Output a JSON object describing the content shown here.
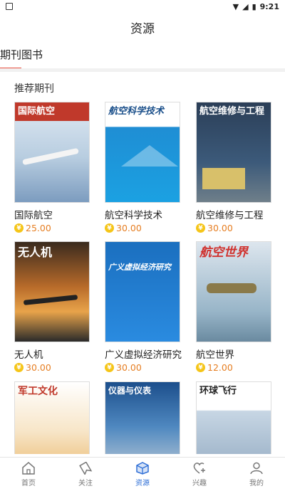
{
  "status_bar": {
    "time": "9:21"
  },
  "header": {
    "title": "资源"
  },
  "subtabs": {
    "active_label": "期刊图书"
  },
  "section": {
    "title": "推荐期刊"
  },
  "journals": [
    {
      "name": "国际航空",
      "price": "25.00",
      "cover_text": "国际航空"
    },
    {
      "name": "航空科学技术",
      "price": "30.00",
      "cover_text": "航空科学技术"
    },
    {
      "name": "航空维修与工程",
      "price": "30.00",
      "cover_text": "航空维修与工程"
    },
    {
      "name": "无人机",
      "price": "30.00",
      "cover_text": "无人机"
    },
    {
      "name": "广义虚拟经济研究",
      "price": "30.00",
      "cover_text": "广义虚拟经济研究"
    },
    {
      "name": "航空世界",
      "price": "12.00",
      "cover_text": "航空世界"
    },
    {
      "name": "",
      "price": "",
      "cover_text": "军工文化"
    },
    {
      "name": "",
      "price": "",
      "cover_text": "仪器与仪表"
    },
    {
      "name": "",
      "price": "",
      "cover_text": "环球飞行"
    }
  ],
  "bottom_nav": {
    "items": [
      {
        "label": "首页",
        "icon": "home-icon"
      },
      {
        "label": "关注",
        "icon": "bookmark-icon"
      },
      {
        "label": "资源",
        "icon": "box-icon"
      },
      {
        "label": "兴趣",
        "icon": "heart-plus-icon"
      },
      {
        "label": "我的",
        "icon": "user-icon"
      }
    ],
    "active_index": 2
  },
  "colors": {
    "accent": "#2f6fd6",
    "price": "#e67e22",
    "tab_underline": "#e74c3c"
  }
}
